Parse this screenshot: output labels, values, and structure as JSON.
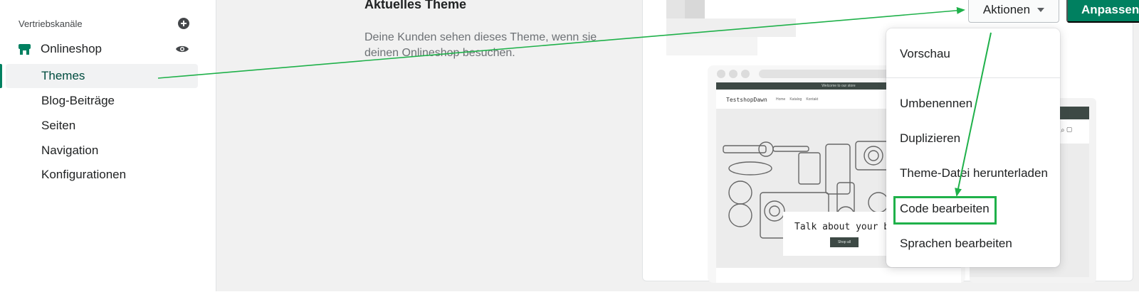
{
  "sidebar": {
    "section_label": "Vertriebskanäle",
    "shop_label": "Onlineshop",
    "items": [
      {
        "label": "Themes"
      },
      {
        "label": "Blog-Beiträge"
      },
      {
        "label": "Seiten"
      },
      {
        "label": "Navigation"
      },
      {
        "label": "Konfigurationen"
      }
    ]
  },
  "main": {
    "title": "Aktuelles Theme",
    "description": "Deine Kunden sehen dieses Theme, wenn sie deinen Onlineshop besuchen."
  },
  "toolbar": {
    "actions_label": "Aktionen",
    "customize_label": "Anpassen"
  },
  "dropdown": {
    "items": [
      {
        "label": "Vorschau"
      },
      {
        "label": "Umbenennen"
      },
      {
        "label": "Duplizieren"
      },
      {
        "label": "Theme-Datei herunterladen"
      },
      {
        "label": "Code bearbeiten"
      },
      {
        "label": "Sprachen bearbeiten"
      }
    ]
  },
  "preview": {
    "announcement": "Welcome to our store",
    "brand": "TestshopDawn",
    "nav": [
      "Home",
      "Katalog",
      "Kontakt"
    ],
    "hero_text": "Talk about your brand",
    "hero_button": "Shop all"
  },
  "colors": {
    "brand_green": "#008060",
    "annotation_green": "#1fb14a"
  },
  "icons": {
    "section_add": "plus-circle-icon",
    "shop": "store-icon",
    "view": "eye-icon",
    "actions_caret": "caret-down-icon"
  }
}
